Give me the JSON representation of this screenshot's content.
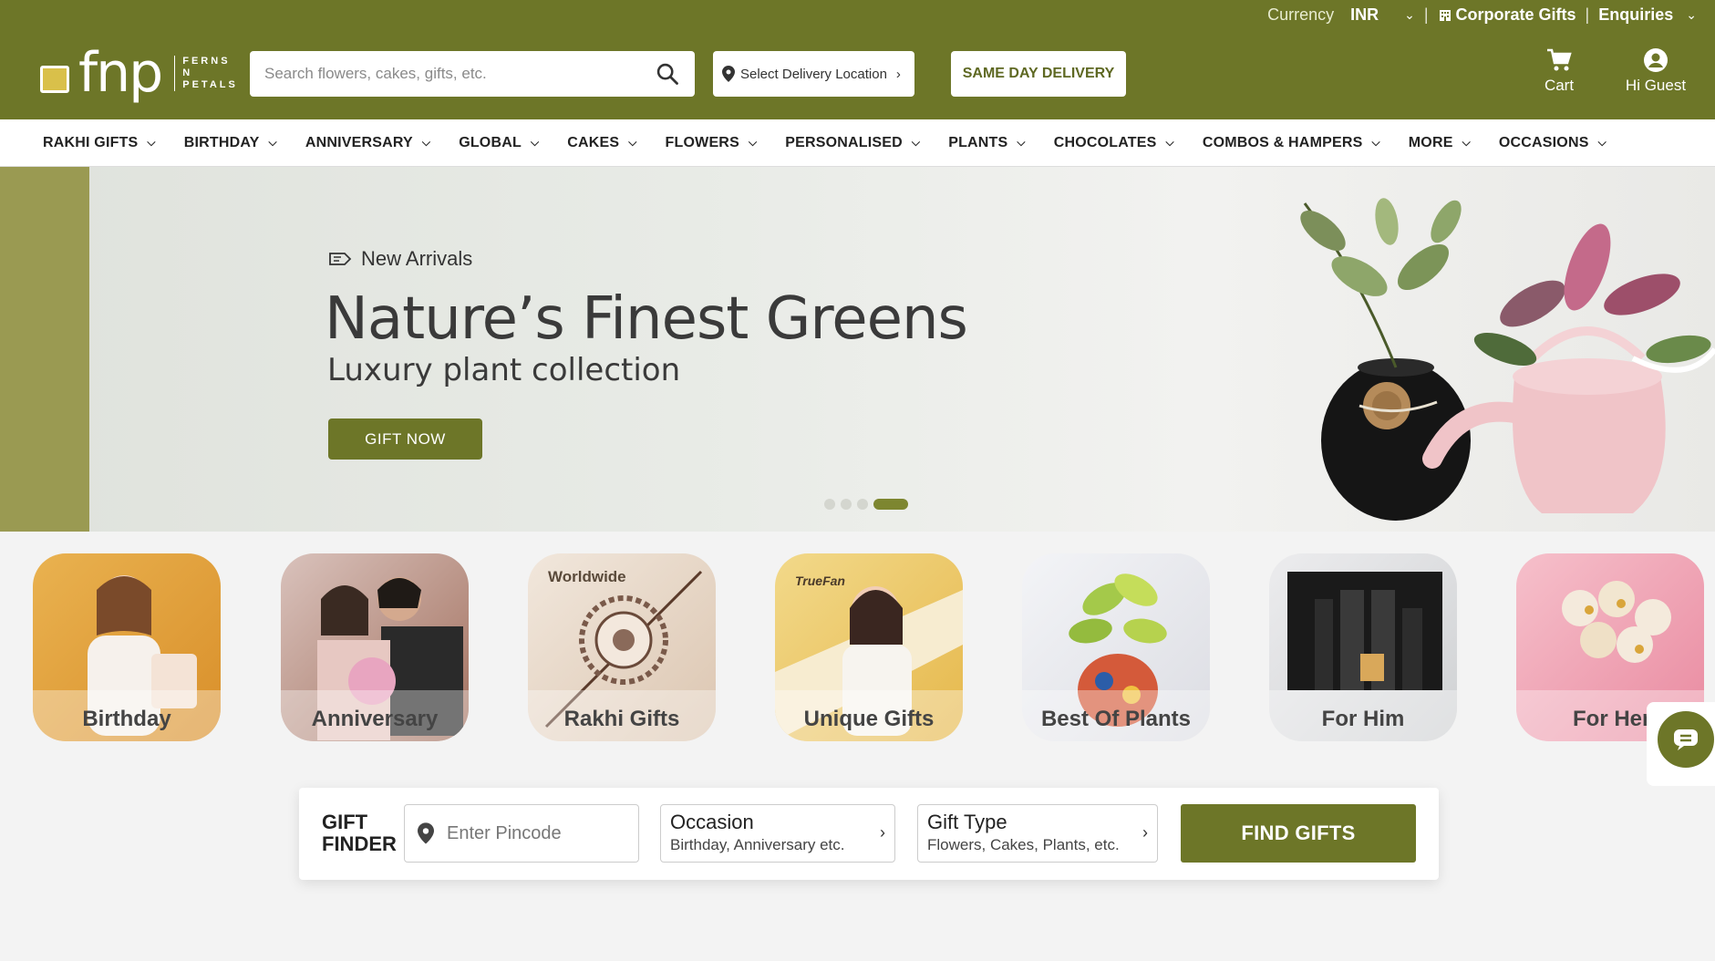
{
  "topbar": {
    "currency_label": "Currency",
    "currency_value": "INR",
    "corporate_gifts": "Corporate Gifts",
    "enquiries": "Enquiries"
  },
  "header": {
    "logo_text": "fnp",
    "logo_sub_1": "FERNS",
    "logo_sub_2": "N",
    "logo_sub_3": "PETALS",
    "search_placeholder": "Search flowers, cakes, gifts, etc.",
    "location_label": "Select Delivery Location",
    "same_day_label": "SAME DAY DELIVERY",
    "cart_label": "Cart",
    "guest_label": "Hi Guest"
  },
  "nav": {
    "items": [
      {
        "label": "RAKHI GIFTS"
      },
      {
        "label": "BIRTHDAY"
      },
      {
        "label": "ANNIVERSARY"
      },
      {
        "label": "GLOBAL"
      },
      {
        "label": "CAKES"
      },
      {
        "label": "FLOWERS"
      },
      {
        "label": "PERSONALISED"
      },
      {
        "label": "PLANTS"
      },
      {
        "label": "CHOCOLATES"
      },
      {
        "label": "COMBOS & HAMPERS"
      },
      {
        "label": "MORE"
      },
      {
        "label": "OCCASIONS"
      }
    ]
  },
  "hero": {
    "tag": "New Arrivals",
    "title": "Nature’s Finest Greens",
    "subtitle": "Luxury plant collection",
    "cta": "GIFT NOW",
    "slides_count": 4,
    "active_slide": 4
  },
  "categories": [
    {
      "label": "Birthday",
      "color": "#e0a23a"
    },
    {
      "label": "Anniversary",
      "color": "#b88a86"
    },
    {
      "label": "Rakhi Gifts",
      "color": "#e6d6c4",
      "badge": "Worldwide"
    },
    {
      "label": "Unique Gifts",
      "color": "#e8c16a",
      "badge": "TrueFan"
    },
    {
      "label": "Best Of Plants",
      "color": "#e3e5ea"
    },
    {
      "label": "For Him",
      "color": "#d5d7d8"
    },
    {
      "label": "For Her",
      "color": "#f0a3b4"
    }
  ],
  "gift_finder": {
    "title_1": "GIFT",
    "title_2": "FINDER",
    "pincode_placeholder": "Enter Pincode",
    "occasion_title": "Occasion",
    "occasion_sub": "Birthday, Anniversary etc.",
    "gift_type_title": "Gift Type",
    "gift_type_sub": "Flowers, Cakes, Plants, etc.",
    "button": "FIND GIFTS"
  },
  "colors": {
    "brand": "#6d7628",
    "hero_strip": "#9a9a52"
  }
}
